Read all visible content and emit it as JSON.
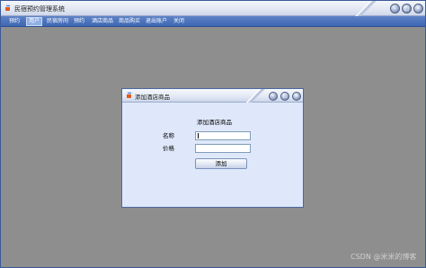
{
  "window": {
    "title": "民宿预约管理系统",
    "icon": "java-cup-icon",
    "controls": [
      "minimize",
      "maximize",
      "close"
    ]
  },
  "menu": {
    "items": [
      {
        "label": "预约",
        "active": false
      },
      {
        "label": "用户",
        "active": true
      },
      {
        "label": "民宿房间",
        "active": false
      },
      {
        "label": "预约",
        "active": false
      },
      {
        "label": "酒店商品",
        "active": false
      },
      {
        "label": "商品购买",
        "active": false
      },
      {
        "label": "退出账户",
        "active": false
      },
      {
        "label": "关闭",
        "active": false
      }
    ]
  },
  "dialog": {
    "title": "添加酒店商品",
    "heading": "添加酒店商品",
    "fields": [
      {
        "label": "名称",
        "value": ""
      },
      {
        "label": "价格",
        "value": ""
      }
    ],
    "submit_label": "添加"
  },
  "watermark": "CSDN @米米的博客",
  "colors": {
    "menu_bar": "#3e67b3",
    "desktop": "#8e8e8e",
    "dialog_body": "#dfe8fa"
  }
}
